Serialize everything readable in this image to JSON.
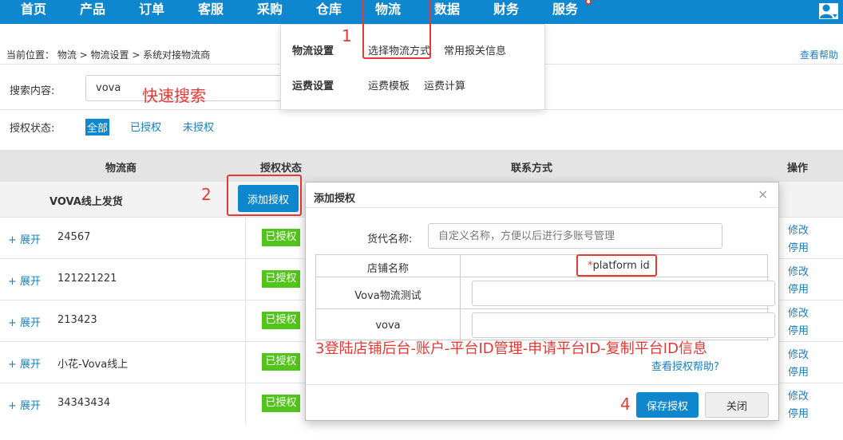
{
  "nav": {
    "items": [
      "首页",
      "产品",
      "订单",
      "客服",
      "采购",
      "仓库",
      "物流",
      "数据",
      "财务",
      "服务"
    ]
  },
  "breadcrumb": "当前位置：  物流 > 物流设置 > 系统对接物流商",
  "help_link": "查看帮助",
  "dropdown": {
    "logistics_settings": "物流设置",
    "choose_method": "选择物流方式",
    "customs_info": "常用报关信息",
    "freight_settings": "运费设置",
    "freight_template": "运费模板",
    "freight_calc": "运费计算"
  },
  "search": {
    "label": "搜索内容:",
    "value": "vova",
    "note": "快速搜索"
  },
  "filter": {
    "label": "授权状态:",
    "all": "全部",
    "authorized": "已授权",
    "unauthorized": "未授权"
  },
  "table": {
    "headers": {
      "provider": "物流商",
      "auth_status": "授权状态",
      "contact": "联系方式",
      "ops": "操作"
    },
    "group_name": "VOVA线上发货",
    "add_button": "添加授权",
    "expand_label": "+ 展开",
    "badge_label": "已授权",
    "edit_label": "修改",
    "disable_label": "停用",
    "rows": [
      "24567",
      "121221221",
      "213423",
      "小花-Vova线上",
      "34343434"
    ]
  },
  "modal": {
    "title": "添加授权",
    "close_icon": "×",
    "agent_label": "货代名称:",
    "agent_placeholder": "自定义名称，方便以后进行多账号管理",
    "col_store": "店铺名称",
    "col_pid_star": "*",
    "col_pid": "platform id",
    "stores": [
      "Vova物流测试",
      "vova"
    ],
    "step3_note": "3登陆店铺后台-账户-平台ID管理-申请平台ID-复制平台ID信息",
    "help_auth": "查看授权帮助?",
    "save": "保存授权",
    "close": "关闭"
  },
  "annotations": {
    "n1": "1",
    "n2": "2",
    "n4": "4"
  },
  "colors": {
    "nav_bg": "#0e87cf",
    "annotation": "#e53935",
    "badge": "#52c41a",
    "link": "#1a7fc1"
  }
}
